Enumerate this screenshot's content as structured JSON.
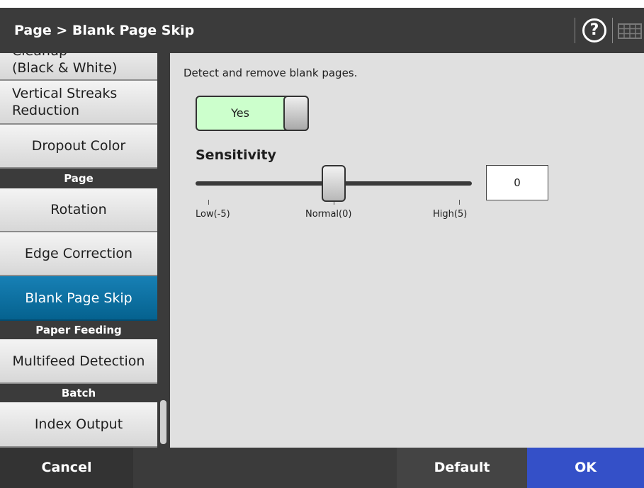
{
  "header": {
    "title": "Page > Blank Page Skip",
    "help_icon": "help-icon",
    "keyboard_icon": "keyboard-icon",
    "help_glyph": "?"
  },
  "sidebar": {
    "items": [
      {
        "type": "button",
        "label": "Cleanup\n(Black & White)"
      },
      {
        "type": "button",
        "label": "Vertical Streaks\nReduction"
      },
      {
        "type": "button",
        "label": "Dropout Color"
      },
      {
        "type": "header",
        "label": "Page"
      },
      {
        "type": "button",
        "label": "Rotation"
      },
      {
        "type": "button",
        "label": "Edge Correction"
      },
      {
        "type": "button",
        "label": "Blank Page Skip",
        "selected": true
      },
      {
        "type": "header",
        "label": "Paper Feeding"
      },
      {
        "type": "button",
        "label": "Multifeed Detection"
      },
      {
        "type": "header",
        "label": "Batch"
      },
      {
        "type": "button",
        "label": "Index Output"
      }
    ]
  },
  "content": {
    "description": "Detect and remove blank pages.",
    "toggle": {
      "label": "Yes",
      "state": "on"
    },
    "sensitivity": {
      "title": "Sensitivity",
      "value": "0",
      "min": -5,
      "max": 5,
      "level": 0,
      "labels": {
        "low": "Low(-5)",
        "normal": "Normal(0)",
        "high": "High(5)"
      }
    }
  },
  "footer": {
    "cancel_label": "Cancel",
    "default_label": "Default",
    "ok_label": "OK"
  },
  "colors": {
    "header_bg": "#3b3b3b",
    "selected_item": "#0a6fa3",
    "toggle_on": "#ccffcc",
    "ok_button": "#3450c8"
  }
}
